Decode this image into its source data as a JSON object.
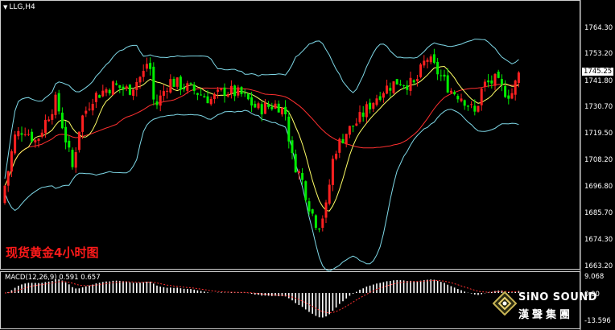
{
  "window": {
    "symbol": "LLG,H4"
  },
  "title_overlay": "现货黄金4小时图",
  "price_axis": {
    "ticks": [
      "1764.30",
      "1753.20",
      "1741.80",
      "1730.70",
      "1719.50",
      "1708.20",
      "1696.80",
      "1685.70",
      "1674.30",
      "1663.20"
    ],
    "current": "1745.25"
  },
  "macd": {
    "label": "MACD(12,26,9) 0.591 0.657",
    "ticks": [
      "9.068",
      "0.00",
      "-13.596"
    ]
  },
  "brand": {
    "name": "SiNO SOUND",
    "chinese": "漢聲集團"
  },
  "colors": {
    "bull": "#ff2020",
    "bear": "#00ee00",
    "bollinger": "#7fd9e8",
    "ma_fast": "#ffff66",
    "ma_slow": "#ff3030",
    "macd_hist": "#ffffff",
    "macd_signal": "#ff3030"
  }
}
